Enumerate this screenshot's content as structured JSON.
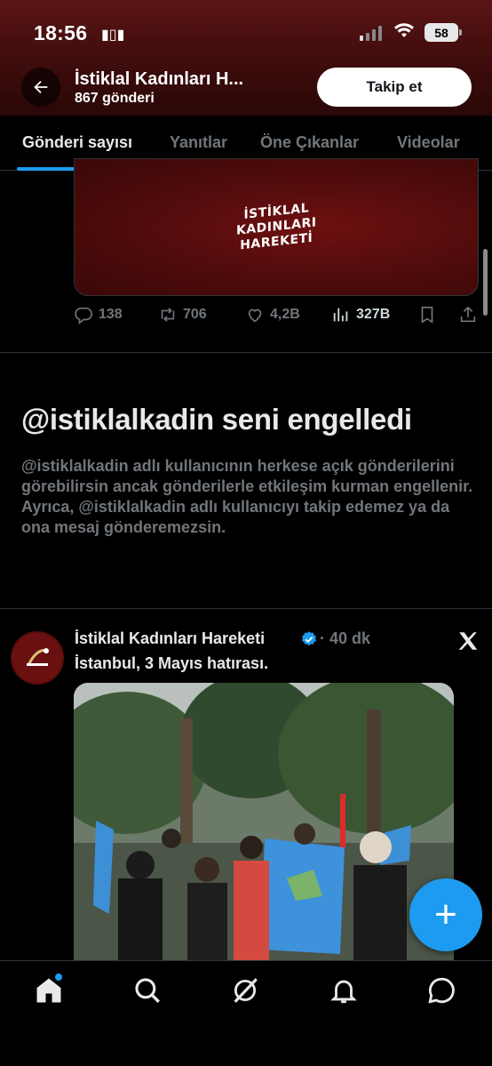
{
  "status_bar": {
    "time": "18:56",
    "battery": "58"
  },
  "header": {
    "back_icon": "arrow-left-icon",
    "profile_name": "İstiklal Kadınları H...",
    "post_count": "867 gönderi",
    "follow_label": "Takip et"
  },
  "tabs": [
    {
      "label": "Gönderi sayısı",
      "active": true
    },
    {
      "label": "Yanıtlar",
      "active": false
    },
    {
      "label": "Öne Çıkanlar",
      "active": false
    },
    {
      "label": "Videolar",
      "active": false
    }
  ],
  "previous_tweet": {
    "logo_lines": [
      "İSTİKLAL",
      "KADINLARI",
      "HAREKETİ"
    ],
    "replies": "138",
    "reposts": "706",
    "likes": "4,2B",
    "views": "327B"
  },
  "blocked_notice": {
    "title": "@istiklalkadin seni engelledi",
    "body": "@istiklalkadin adlı kullanıcının herkese açık gönderilerini görebilirsin ancak gönderilerle etkileşim kurman engellenir. Ayrıca, @istiklalkadin adlı kullanıcıyı takip edemez ya da ona mesaj gönderemezsin."
  },
  "tweet": {
    "author": "İstiklal Kadınları Hareketi",
    "time": "· 40 dk",
    "text": "İstanbul, 3 Mayıs hatırası."
  },
  "fab_label": "+",
  "colors": {
    "accent": "#1d9bf0",
    "banner": "#4a0f0f",
    "muted_text": "#71767b"
  },
  "bottom_nav": [
    "home-icon",
    "search-icon",
    "grok-icon",
    "bell-icon",
    "messages-icon"
  ]
}
